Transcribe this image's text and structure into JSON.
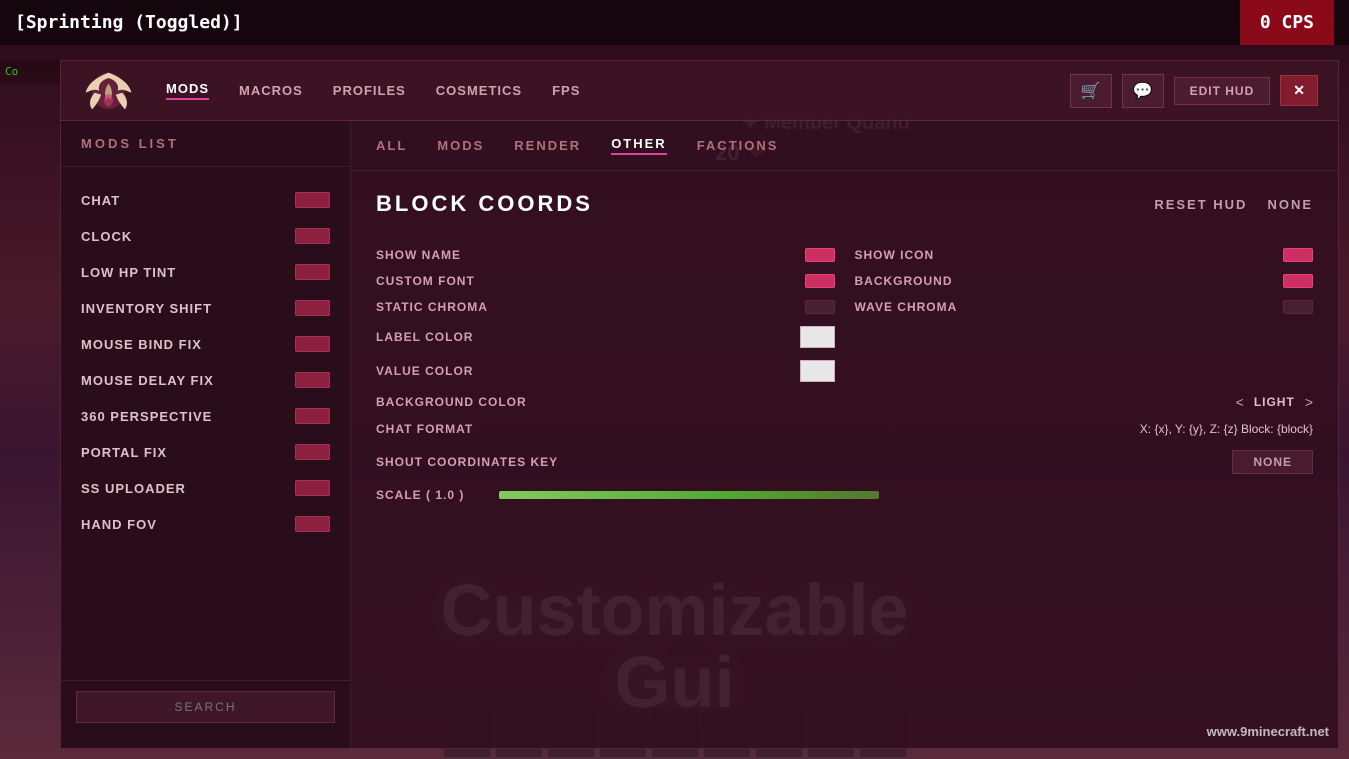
{
  "top_hud": {
    "sprinting_text": "[Sprinting (Toggled)]",
    "cps_text": "0 CPS"
  },
  "left_game": {
    "title": "Co",
    "hp": "20",
    "member_text": "✦ Member Quand"
  },
  "header": {
    "nav_items": [
      {
        "label": "MODS",
        "active": true
      },
      {
        "label": "MACROS",
        "active": false
      },
      {
        "label": "PROFILES",
        "active": false
      },
      {
        "label": "COSMETICS",
        "active": false
      },
      {
        "label": "FPS",
        "active": false
      }
    ],
    "edit_hud_label": "EDIT HUD",
    "close_label": "✕",
    "cart_icon": "🛒",
    "discord_icon": "💬"
  },
  "sidebar": {
    "title": "MODS LIST",
    "mods": [
      {
        "name": "CHAT",
        "enabled": false
      },
      {
        "name": "CLOCK",
        "enabled": false
      },
      {
        "name": "LOW HP TINT",
        "enabled": false
      },
      {
        "name": "INVENTORY SHIFT",
        "enabled": false
      },
      {
        "name": "MOUSE BIND FIX",
        "enabled": false
      },
      {
        "name": "MOUSE DELAY FIX",
        "enabled": false
      },
      {
        "name": "360 PERSPECTIVE",
        "enabled": false
      },
      {
        "name": "PORTAL FIX",
        "enabled": false
      },
      {
        "name": "SS UPLOADER",
        "enabled": false
      },
      {
        "name": "HAND FOV",
        "enabled": false
      }
    ],
    "search_placeholder": "SEARCH"
  },
  "filter_tabs": [
    {
      "label": "ALL",
      "active": false
    },
    {
      "label": "MODS",
      "active": false
    },
    {
      "label": "RENDER",
      "active": false
    },
    {
      "label": "OTHER",
      "active": true
    },
    {
      "label": "FACTIONS",
      "active": false
    }
  ],
  "block_coords": {
    "title": "BLOCK COORDS",
    "reset_hud_label": "RESET HUD",
    "none_label": "NONE",
    "settings": {
      "show_name": {
        "label": "SHOW NAME",
        "side": "left"
      },
      "custom_font": {
        "label": "CUSTOM FONT",
        "side": "left"
      },
      "static_chroma": {
        "label": "STATIC CHROMA",
        "side": "left"
      },
      "label_color": {
        "label": "LABEL COLOR",
        "side": "left"
      },
      "value_color": {
        "label": "VALUE COLOR",
        "side": "left"
      },
      "show_icon": {
        "label": "SHOW ICON",
        "side": "right"
      },
      "background": {
        "label": "BACKGROUND",
        "side": "right"
      },
      "wave_chroma": {
        "label": "WAVE CHROMA",
        "side": "right"
      }
    },
    "background_color": {
      "label": "BACKGROUND COLOR",
      "arrow_left": "<",
      "value": "LIGHT",
      "arrow_right": ">"
    },
    "chat_format": {
      "label": "CHAT FORMAT",
      "value": "X: {x}, Y: {y}, Z: {z} Block: {block}"
    },
    "shout_key": {
      "label": "SHOUT COORDINATES KEY",
      "value": "NONE"
    },
    "scale": {
      "label": "SCALE ( 1.0 )"
    }
  },
  "watermark": "www.9minecraft.net",
  "big_text": {
    "line1": "Customizable",
    "line2": "Gui"
  }
}
